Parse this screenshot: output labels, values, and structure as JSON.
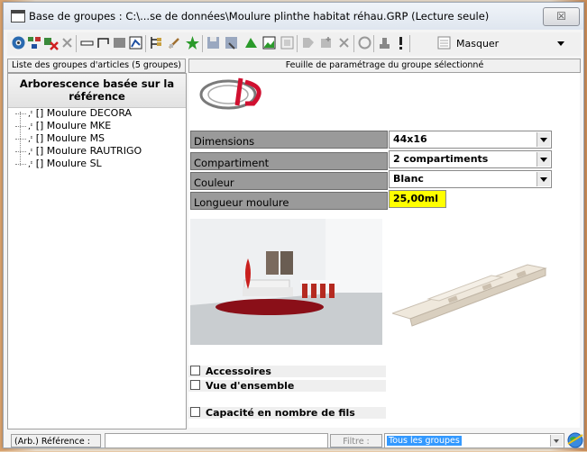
{
  "window": {
    "title": "Base de groupes : C:\\...se de données\\Moulure plinthe habitat réhau.GRP (Lecture seule)",
    "close_label": "☒"
  },
  "toolbar": {
    "masquer_label": "Masquer"
  },
  "headers": {
    "left": "Liste des groupes d'articles (5 groupes)",
    "right": "Feuille de paramétrage du groupe sélectionné"
  },
  "tree": {
    "title_line1": "Arborescence basée sur la",
    "title_line2": "référence",
    "items": [
      {
        "label": "[] Moulure DECORA"
      },
      {
        "label": "[] Moulure MKE"
      },
      {
        "label": "[] Moulure MS"
      },
      {
        "label": "[] Moulure RAUTRIGO"
      },
      {
        "label": "[] Moulure SL"
      }
    ]
  },
  "fields": [
    {
      "label": "Dimensions",
      "value": "44x16"
    },
    {
      "label": "Compartiment",
      "value": "2 compartiments"
    },
    {
      "label": "Couleur",
      "value": "Blanc"
    },
    {
      "label": "Longueur moulure",
      "value": "25,00ml"
    }
  ],
  "checkboxes": [
    {
      "label": "Accessoires"
    },
    {
      "label": "Vue d'ensemble"
    },
    {
      "label": "Capacité en nombre de fils"
    }
  ],
  "statusbar": {
    "ref_label": "(Arb.) Référence :",
    "ref_value": "",
    "filtre_label": "Filtre :",
    "filtre_value": "Tous les groupes"
  },
  "colors": {
    "highlight_yellow": "#ffff00",
    "field_label_bg": "#9a9a9a",
    "selection_blue": "#3399ff"
  }
}
